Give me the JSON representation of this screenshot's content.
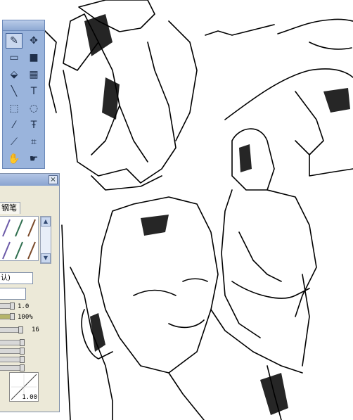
{
  "toolbox": {
    "tools": [
      {
        "name": "pencil-tool-icon",
        "selected": true
      },
      {
        "name": "move-tool-icon",
        "selected": false
      },
      {
        "name": "rectangle-tool-icon",
        "selected": false
      },
      {
        "name": "fill-rect-tool-icon",
        "selected": false
      },
      {
        "name": "bucket-tool-icon",
        "selected": false
      },
      {
        "name": "gradient-tool-icon",
        "selected": false
      },
      {
        "name": "line-tool-icon",
        "selected": false
      },
      {
        "name": "text-tool-icon",
        "selected": false
      },
      {
        "name": "rect-select-tool-icon",
        "selected": false
      },
      {
        "name": "lasso-tool-icon",
        "selected": false
      },
      {
        "name": "magic-wand-tool-icon",
        "selected": false
      },
      {
        "name": "text-select-tool-icon",
        "selected": false
      },
      {
        "name": "eyedropper-tool-icon",
        "selected": false
      },
      {
        "name": "crop-tool-icon",
        "selected": false
      },
      {
        "name": "hand-tool-icon",
        "selected": false
      },
      {
        "name": "rotate-hand-tool-icon",
        "selected": false
      }
    ]
  },
  "brush_panel": {
    "close_label": "×",
    "tab_label": "钢笔",
    "preset_value": "认)",
    "second_field_value": "",
    "slider_1_value": "1.0",
    "slider_2_value": "100%",
    "slider_3_value": "16",
    "curve_value": "1.00",
    "slider_fractions": [
      0.9,
      0.92,
      1.0,
      0.85,
      0.85,
      0.85,
      0.85
    ],
    "accent_color": "#b5b56a"
  }
}
